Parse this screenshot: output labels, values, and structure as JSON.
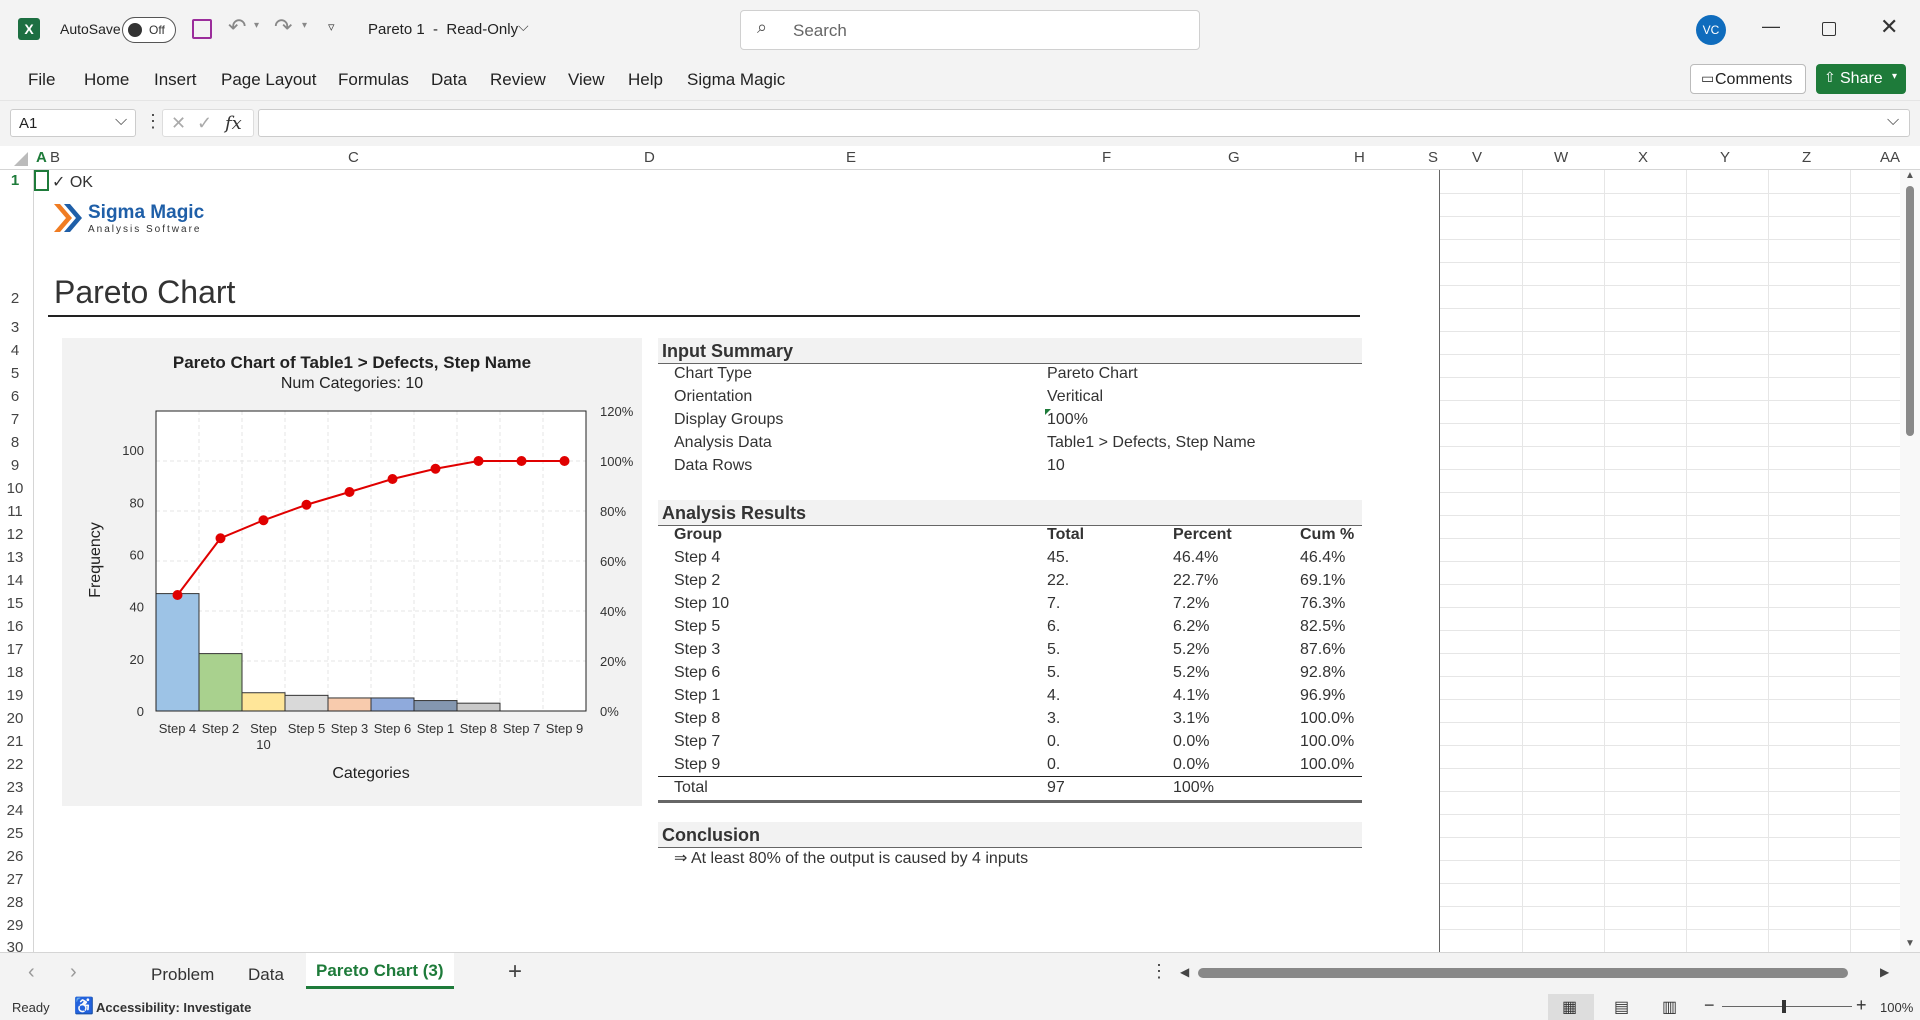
{
  "titlebar": {
    "autosave_label": "AutoSave",
    "autosave_state": "Off",
    "doc_title": "Pareto 1  -  Read-Only",
    "search_placeholder": "Search",
    "user_initials": "VC"
  },
  "ribbon": {
    "tabs": [
      "File",
      "Home",
      "Insert",
      "Page Layout",
      "Formulas",
      "Data",
      "Review",
      "View",
      "Help",
      "Sigma Magic"
    ],
    "comments_label": "Comments",
    "share_label": "Share"
  },
  "formula_bar": {
    "name_box": "A1",
    "fx_label": "fx",
    "formula": ""
  },
  "columns": [
    "A",
    "B",
    "C",
    "D",
    "E",
    "F",
    "G",
    "H",
    "S",
    "V",
    "W",
    "X",
    "Y",
    "Z",
    "AA"
  ],
  "rows": [
    "1",
    "2",
    "3",
    "4",
    "5",
    "6",
    "7",
    "8",
    "9",
    "10",
    "11",
    "12",
    "13",
    "14",
    "15",
    "16",
    "17",
    "18",
    "19",
    "20",
    "21",
    "22",
    "23",
    "24",
    "25",
    "26",
    "27",
    "28",
    "29",
    "30"
  ],
  "sheet": {
    "ok_text": "✓ OK",
    "logo_name": "Sigma Magic",
    "logo_sub": "Analysis Software",
    "page_title": "Pareto Chart",
    "input_summary": {
      "title": "Input Summary",
      "rows": [
        {
          "label": "Chart Type",
          "value": "Pareto Chart"
        },
        {
          "label": "Orientation",
          "value": "Veritical"
        },
        {
          "label": "Display Groups",
          "value": "100%"
        },
        {
          "label": "Analysis Data",
          "value": "Table1 > Defects, Step Name"
        },
        {
          "label": "Data Rows",
          "value": "10"
        }
      ]
    },
    "analysis_results": {
      "title": "Analysis Results",
      "headers": [
        "Group",
        "Total",
        "Percent",
        "Cum %"
      ],
      "rows": [
        [
          "Step 4",
          "45.",
          "46.4%",
          "46.4%"
        ],
        [
          "Step 2",
          "22.",
          "22.7%",
          "69.1%"
        ],
        [
          "Step 10",
          "7.",
          "7.2%",
          "76.3%"
        ],
        [
          "Step 5",
          "6.",
          "6.2%",
          "82.5%"
        ],
        [
          "Step 3",
          "5.",
          "5.2%",
          "87.6%"
        ],
        [
          "Step 6",
          "5.",
          "5.2%",
          "92.8%"
        ],
        [
          "Step 1",
          "4.",
          "4.1%",
          "96.9%"
        ],
        [
          "Step 8",
          "3.",
          "3.1%",
          "100.0%"
        ],
        [
          "Step 7",
          "0.",
          "0.0%",
          "100.0%"
        ],
        [
          "Step 9",
          "0.",
          "0.0%",
          "100.0%"
        ]
      ],
      "total_row": [
        "Total",
        "97",
        "100%",
        ""
      ]
    },
    "conclusion": {
      "title": "Conclusion",
      "text": "⇒ At least 80% of the output is caused by 4 inputs"
    }
  },
  "chart_data": {
    "type": "bar",
    "title": "Pareto Chart of Table1 > Defects, Step Name",
    "subtitle": "Num Categories: 10",
    "xlabel": "Categories",
    "ylabel": "Frequency",
    "categories": [
      "Step 4",
      "Step 2",
      "Step 10",
      "Step 5",
      "Step 3",
      "Step 6",
      "Step 1",
      "Step 8",
      "Step 7",
      "Step 9"
    ],
    "series": [
      {
        "values": [
          45,
          22,
          7,
          6,
          5,
          5,
          4,
          3,
          0,
          0
        ],
        "type": "bar"
      },
      {
        "values": [
          46.4,
          69.1,
          76.3,
          82.5,
          87.6,
          92.8,
          96.9,
          100,
          100,
          100
        ],
        "type": "line",
        "axis": "right"
      }
    ],
    "bar_colors": [
      "#9dc3e6",
      "#a9d18e",
      "#ffe699",
      "#d9d9d9",
      "#f8cbad",
      "#8faadc",
      "#8497b0",
      "#c9c9c9",
      "#bdd7ee",
      "#c5e0b4"
    ],
    "line_color": "#e00000",
    "ylim": [
      0,
      115
    ],
    "y_ticks": [
      "0",
      "20",
      "40",
      "60",
      "80",
      "100"
    ],
    "y2lim": [
      0,
      120
    ],
    "y2_ticks": [
      "0%",
      "20%",
      "40%",
      "60%",
      "80%",
      "100%",
      "120%"
    ],
    "grid": true
  },
  "sheet_tabs": [
    "Problem",
    "Data",
    "Pareto Chart (3)"
  ],
  "active_tab": "Pareto Chart (3)",
  "status": {
    "ready": "Ready",
    "accessibility": "Accessibility: Investigate",
    "zoom": "100%"
  }
}
